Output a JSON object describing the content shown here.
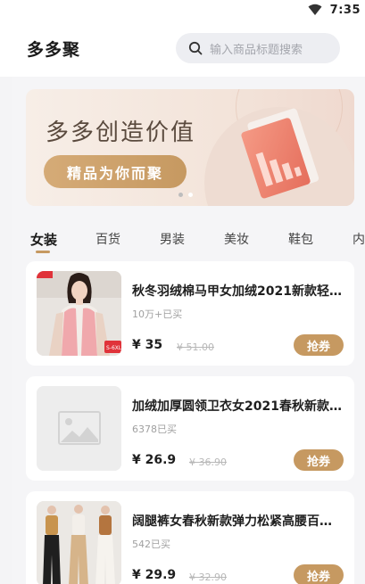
{
  "status_bar": {
    "time": "7:35",
    "wifi_icon": "wifi-icon"
  },
  "header": {
    "title": "多多聚",
    "search": {
      "icon": "search-icon",
      "placeholder": "输入商品标题搜索"
    }
  },
  "banner": {
    "title": "多多创造价值",
    "button_label": "精品为你而聚",
    "slides": 2,
    "active_slide": 0
  },
  "tabs": [
    {
      "label": "女装",
      "active": true
    },
    {
      "label": "百货",
      "active": false
    },
    {
      "label": "男装",
      "active": false
    },
    {
      "label": "美妆",
      "active": false
    },
    {
      "label": "鞋包",
      "active": false
    },
    {
      "label": "内",
      "active": false
    }
  ],
  "products": [
    {
      "title": "秋冬羽绒棉马甲女加绒2021新款轻…",
      "sold": "10万+已买",
      "price": "¥ 35",
      "original_price": "¥ 51.00",
      "coupon_label": "抢券",
      "image": "model-vest-photo"
    },
    {
      "title": "加绒加厚圆领卫衣女2021春秋新款…",
      "sold": "6378已买",
      "price": "¥ 26.9",
      "original_price": "¥ 36.90",
      "coupon_label": "抢券",
      "image": "image-placeholder-icon"
    },
    {
      "title": "阔腿裤女春秋新款弹力松紧高腰百搭…",
      "sold": "542已买",
      "price": "¥ 29.9",
      "original_price": "¥ 32.90",
      "coupon_label": "抢券",
      "image": "wide-leg-pants-photo"
    }
  ],
  "colors": {
    "accent": "#c69961",
    "banner_bg": "#f3e4da",
    "banner_art": "#ef7f6c"
  }
}
